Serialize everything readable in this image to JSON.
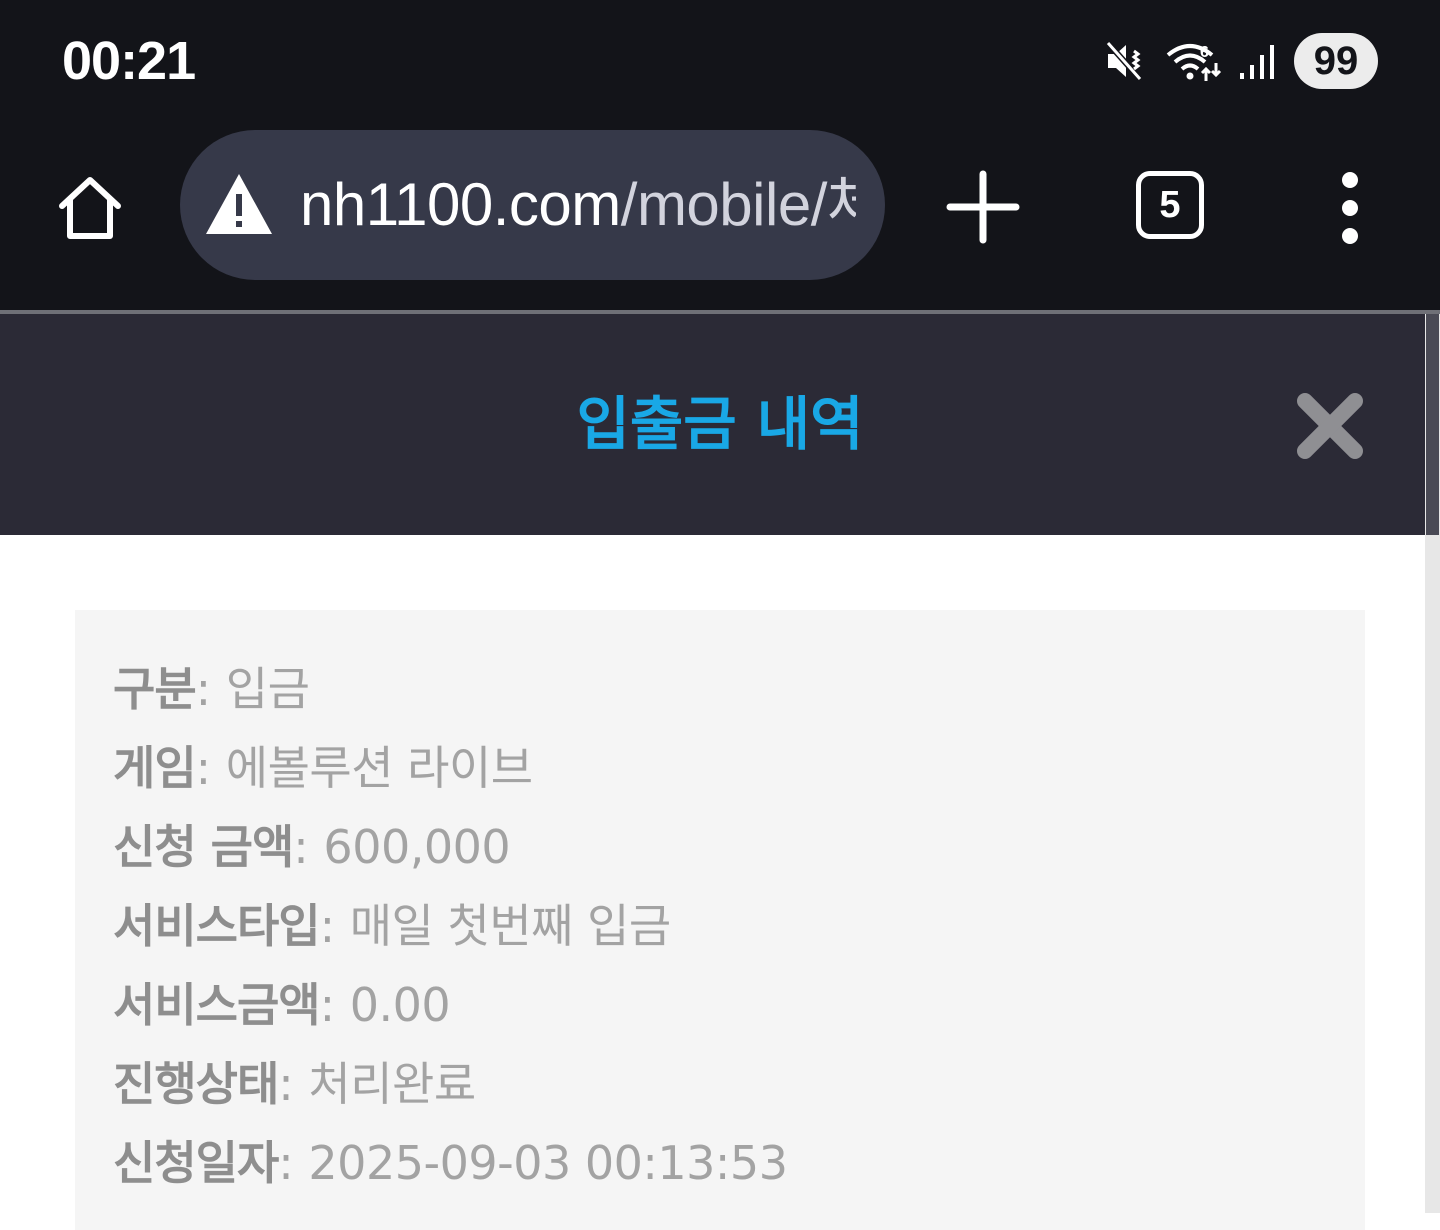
{
  "status_bar": {
    "time": "00:21",
    "battery": "99",
    "icons": [
      "mute-icon",
      "wifi-icon",
      "signal-icon"
    ]
  },
  "browser": {
    "url_host": "nh1100.com",
    "url_path": "/mobile/체",
    "tab_count": "5",
    "icons": [
      "home-icon",
      "warning-icon",
      "plus-icon",
      "more-vert-icon"
    ]
  },
  "modal": {
    "title": "입출금 내역",
    "close_icon": "close-icon",
    "title_color": "#19a8e6"
  },
  "details": [
    {
      "label": "구분",
      "value": "입금"
    },
    {
      "label": "게임",
      "value": "에볼루션 라이브"
    },
    {
      "label": "신청 금액",
      "value": "600,000"
    },
    {
      "label": "서비스타입",
      "value": "매일 첫번째 입금"
    },
    {
      "label": "서비스금액",
      "value": "0.00"
    },
    {
      "label": "진행상태",
      "value": "처리완료"
    },
    {
      "label": "신청일자",
      "value": "2025-09-03 00:13:53"
    }
  ]
}
